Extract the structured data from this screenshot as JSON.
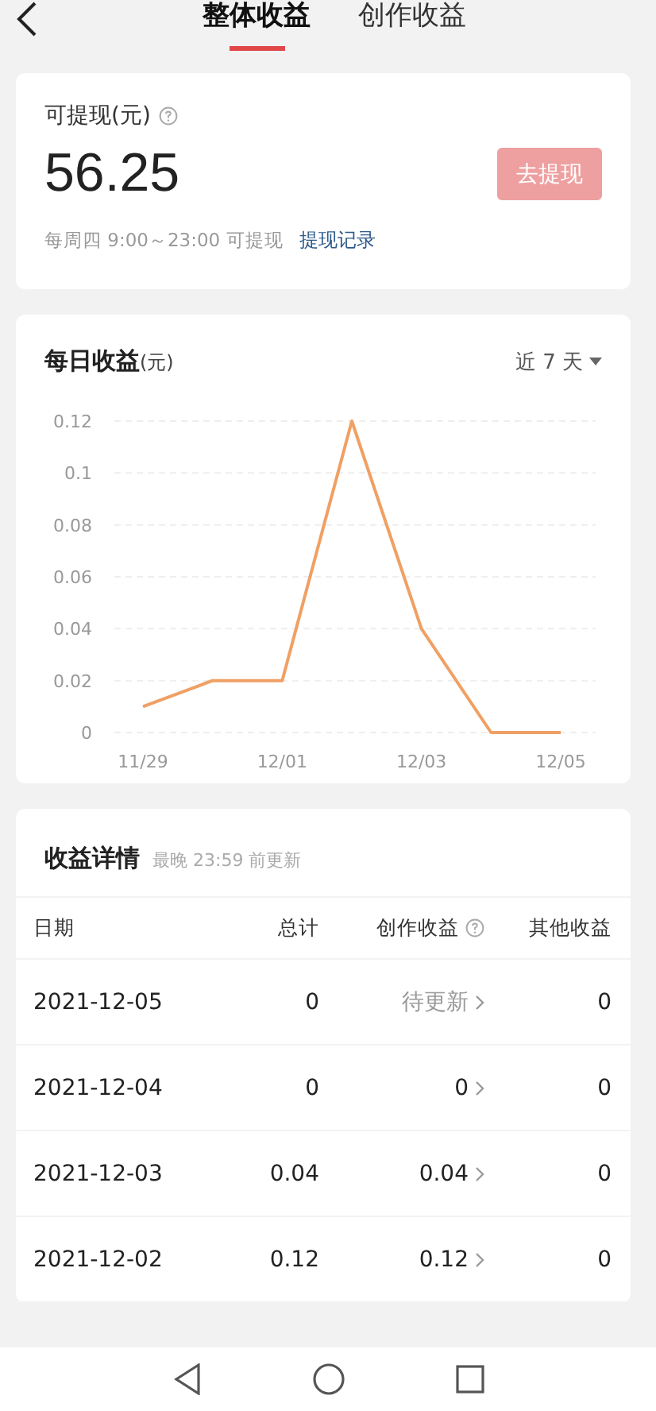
{
  "header": {
    "tabs": [
      {
        "label": "整体收益",
        "selected": true
      },
      {
        "label": "创作收益",
        "selected": false
      }
    ]
  },
  "balance": {
    "label": "可提现(元)",
    "amount": "56.25",
    "button": "去提现",
    "button_disabled": true,
    "note": "每周四 9:00～23:00 可提现",
    "link": "提现记录"
  },
  "daily": {
    "title": "每日收益",
    "unit": "(元)",
    "range": "近 7 天",
    "chart_data": {
      "type": "line",
      "grid": true,
      "categories": [
        "11/29",
        null,
        "12/01",
        null,
        "12/03",
        null,
        "12/05"
      ],
      "yticks": [
        {
          "value": 0,
          "label": "0"
        },
        {
          "value": 0.02,
          "label": "0.02"
        },
        {
          "value": 0.04,
          "label": "0.04"
        },
        {
          "value": 0.06,
          "label": "0.06"
        },
        {
          "value": 0.08,
          "label": "0.08"
        },
        {
          "value": 0.1,
          "label": "0.1"
        },
        {
          "value": 0.12,
          "label": "0.12"
        }
      ],
      "ylim": [
        0,
        0.12
      ],
      "series": [
        {
          "color": "#f0a064",
          "values": [
            0.01,
            0.02,
            0.02,
            0.12,
            0.04,
            0,
            0
          ]
        }
      ]
    }
  },
  "details": {
    "title": "收益详情",
    "subtitle": "最晚 23:59 前更新",
    "columns": [
      "日期",
      "总计",
      "创作收益",
      "其他收益"
    ],
    "rows": [
      {
        "date": "2021-12-05",
        "total": "0",
        "creation": "待更新",
        "pending": true,
        "other": "0"
      },
      {
        "date": "2021-12-04",
        "total": "0",
        "creation": "0",
        "pending": false,
        "other": "0"
      },
      {
        "date": "2021-12-03",
        "total": "0.04",
        "creation": "0.04",
        "pending": false,
        "other": "0"
      },
      {
        "date": "2021-12-02",
        "total": "0.12",
        "creation": "0.12",
        "pending": false,
        "other": "0"
      }
    ]
  }
}
